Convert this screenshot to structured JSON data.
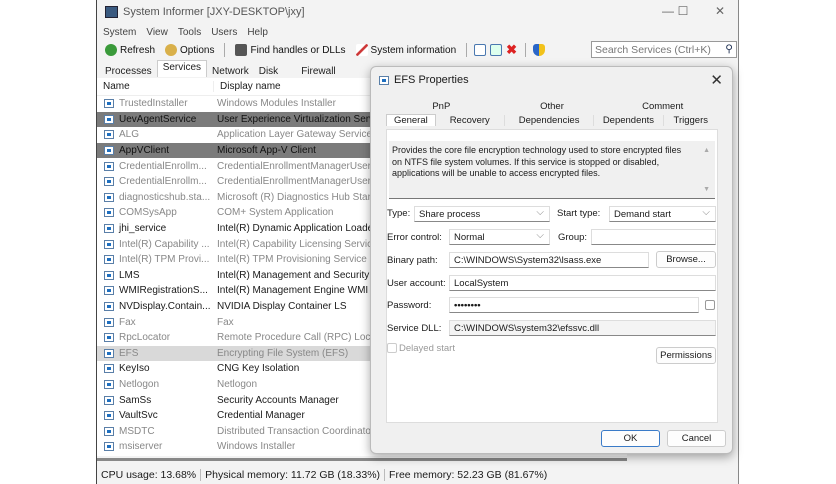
{
  "window": {
    "title": "System Informer [JXY-DESKTOP\\jxy]",
    "minimize": "—",
    "maximize": "☐",
    "close": "✕"
  },
  "menu": [
    "System",
    "View",
    "Tools",
    "Users",
    "Help"
  ],
  "toolbar": {
    "refresh": "Refresh",
    "options": "Options",
    "find": "Find handles or DLLs",
    "sysinfo": "System information",
    "search_placeholder": "Search Services (Ctrl+K)"
  },
  "tabs": [
    "Processes",
    "Services",
    "Network",
    "Disk",
    "Firewall"
  ],
  "columns": {
    "name": "Name",
    "display": "Display name"
  },
  "services": [
    {
      "name": "TrustedInstaller",
      "display": "Windows Modules Installer",
      "state": "stopped"
    },
    {
      "name": "UevAgentService",
      "display": "User Experience Virtualization Service",
      "state": "disabled"
    },
    {
      "name": "ALG",
      "display": "Application Layer Gateway Service",
      "state": "stopped"
    },
    {
      "name": "AppVClient",
      "display": "Microsoft App-V Client",
      "state": "disabled"
    },
    {
      "name": "CredentialEnrollm...",
      "display": "CredentialEnrollmentManagerUserSvc",
      "state": "stopped"
    },
    {
      "name": "CredentialEnrollm...",
      "display": "CredentialEnrollmentManagerUserSvc",
      "state": "stopped"
    },
    {
      "name": "diagnosticshub.sta...",
      "display": "Microsoft (R) Diagnostics Hub Standard",
      "state": "stopped"
    },
    {
      "name": "COMSysApp",
      "display": "COM+ System Application",
      "state": "stopped"
    },
    {
      "name": "jhi_service",
      "display": "Intel(R) Dynamic Application Loader",
      "state": "running"
    },
    {
      "name": "Intel(R) Capability ...",
      "display": "Intel(R) Capability Licensing Service",
      "state": "stopped"
    },
    {
      "name": "Intel(R) TPM Provi...",
      "display": "Intel(R) TPM Provisioning Service",
      "state": "stopped"
    },
    {
      "name": "LMS",
      "display": "Intel(R) Management and Security Application",
      "state": "running"
    },
    {
      "name": "WMIRegistrationS...",
      "display": "Intel(R) Management Engine WMI Provider",
      "state": "running"
    },
    {
      "name": "NVDisplay.Contain...",
      "display": "NVIDIA Display Container LS",
      "state": "running"
    },
    {
      "name": "Fax",
      "display": "Fax",
      "state": "stopped"
    },
    {
      "name": "RpcLocator",
      "display": "Remote Procedure Call (RPC) Locator",
      "state": "stopped"
    },
    {
      "name": "EFS",
      "display": "Encrypting File System (EFS)",
      "state": "selected"
    },
    {
      "name": "KeyIso",
      "display": "CNG Key Isolation",
      "state": "running"
    },
    {
      "name": "Netlogon",
      "display": "Netlogon",
      "state": "stopped"
    },
    {
      "name": "SamSs",
      "display": "Security Accounts Manager",
      "state": "running"
    },
    {
      "name": "VaultSvc",
      "display": "Credential Manager",
      "state": "running"
    },
    {
      "name": "MSDTC",
      "display": "Distributed Transaction Coordinator",
      "state": "stopped"
    },
    {
      "name": "msiserver",
      "display": "Windows Installer",
      "state": "stopped"
    }
  ],
  "status": {
    "cpu": "CPU usage: 13.68%",
    "phys": "Physical memory: 11.72 GB (18.33%)",
    "free": "Free memory: 52.23 GB (81.67%)"
  },
  "dialog": {
    "title": "EFS Properties",
    "close": "✕",
    "tabs_top": [
      "PnP",
      "Other",
      "Comment"
    ],
    "tabs_bottom": [
      "General",
      "Recovery",
      "Dependencies",
      "Dependents",
      "Triggers"
    ],
    "description": "Provides the core file encryption technology used to store encrypted files on NTFS file system volumes. If this service is stopped or disabled, applications will be unable to access encrypted files.",
    "type_label": "Type:",
    "type_value": "Share process",
    "start_label": "Start type:",
    "start_value": "Demand start",
    "error_label": "Error control:",
    "error_value": "Normal",
    "group_label": "Group:",
    "group_value": "",
    "binary_label": "Binary path:",
    "binary_value": "C:\\WINDOWS\\System32\\lsass.exe",
    "browse": "Browse...",
    "account_label": "User account:",
    "account_value": "LocalSystem",
    "password_label": "Password:",
    "password_value": "••••••••",
    "dll_label": "Service DLL:",
    "dll_value": "C:\\WINDOWS\\system32\\efssvc.dll",
    "delayed": "Delayed start",
    "permissions": "Permissions",
    "ok": "OK",
    "cancel": "Cancel"
  }
}
